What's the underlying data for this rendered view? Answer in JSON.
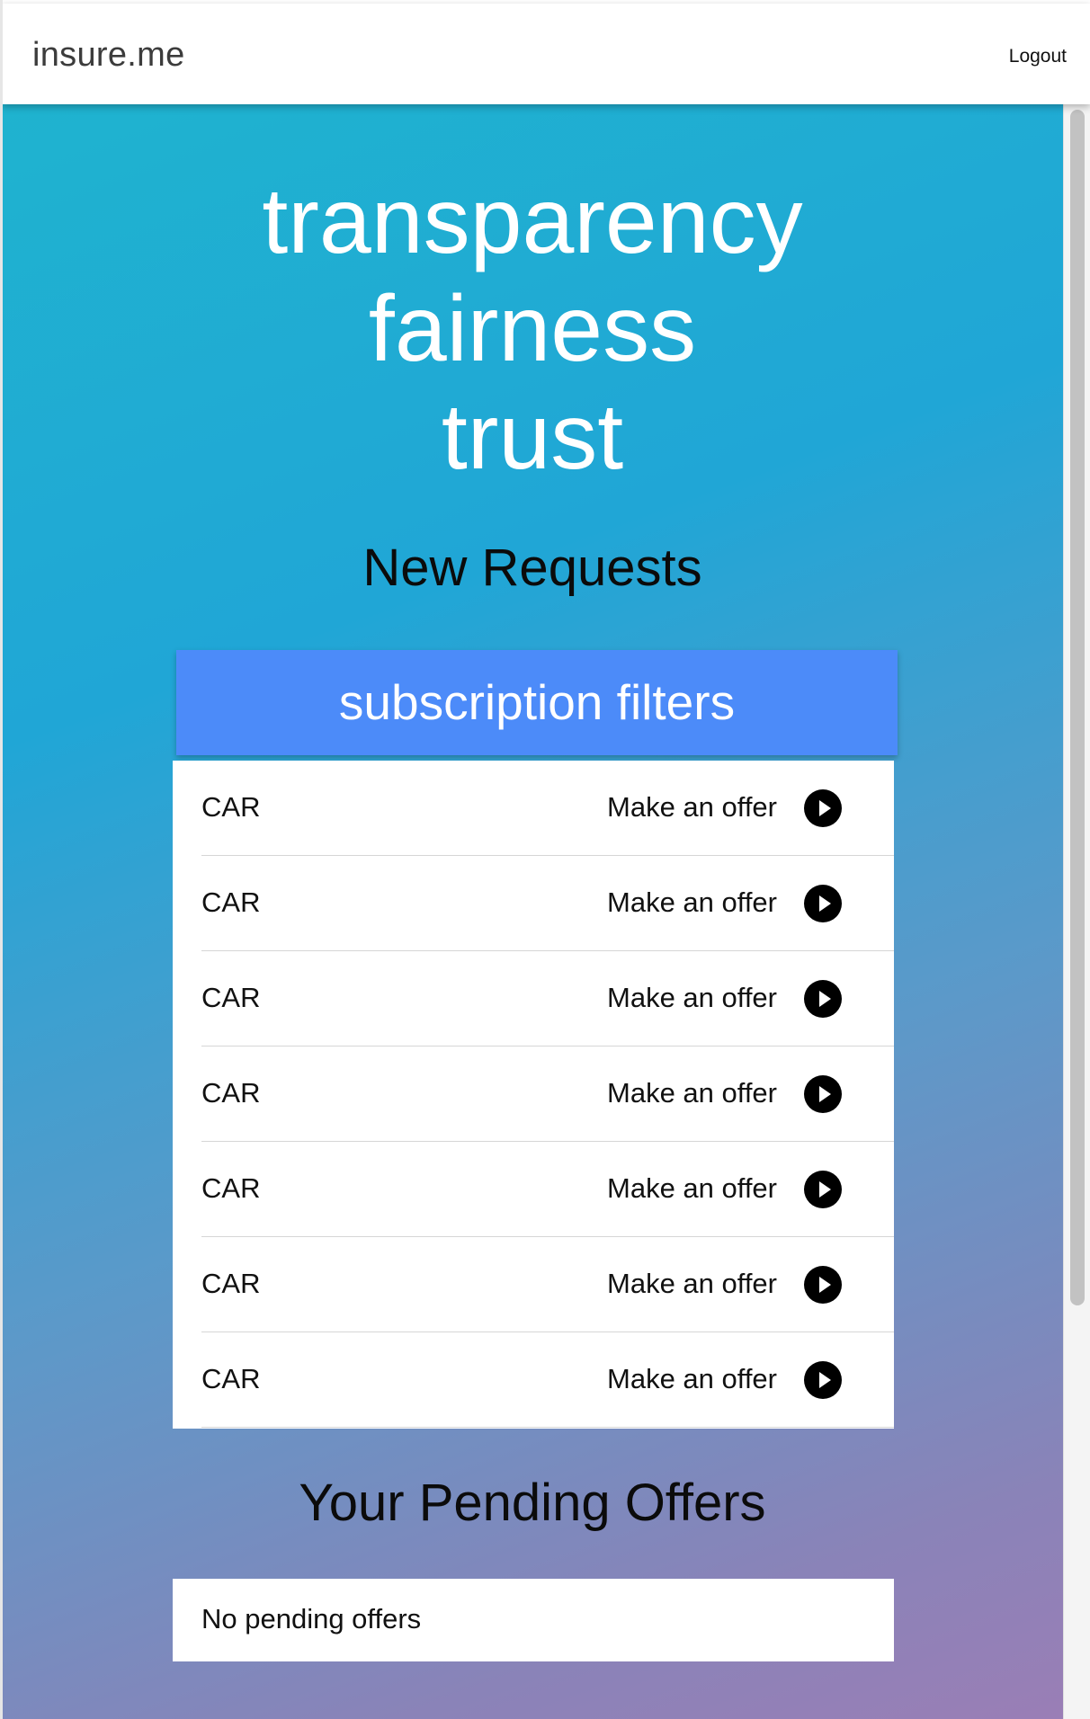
{
  "header": {
    "brand": "insure.me",
    "logout_label": "Logout"
  },
  "hero": {
    "lines": [
      "transparency",
      "fairness",
      "trust"
    ]
  },
  "new_requests": {
    "title": "New Requests",
    "filter_button": "subscription filters",
    "items": [
      {
        "type": "CAR",
        "action": "Make an offer",
        "icon": "play-circle-icon"
      },
      {
        "type": "CAR",
        "action": "Make an offer",
        "icon": "play-circle-icon"
      },
      {
        "type": "CAR",
        "action": "Make an offer",
        "icon": "play-circle-icon"
      },
      {
        "type": "CAR",
        "action": "Make an offer",
        "icon": "play-circle-icon"
      },
      {
        "type": "CAR",
        "action": "Make an offer",
        "icon": "play-circle-icon"
      },
      {
        "type": "CAR",
        "action": "Make an offer",
        "icon": "play-circle-icon"
      },
      {
        "type": "CAR",
        "action": "Make an offer",
        "icon": "play-circle-icon"
      }
    ]
  },
  "pending_offers": {
    "title": "Your Pending Offers",
    "empty_text": "No pending offers"
  },
  "colors": {
    "filter_button_bg": "#4c8bf9",
    "gradient_start": "#1fb3cf",
    "gradient_end": "#9a7eb6"
  }
}
